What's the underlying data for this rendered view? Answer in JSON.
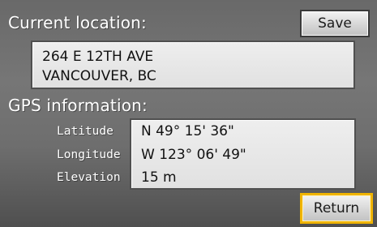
{
  "current_location": {
    "title": "Current location:",
    "save_label": "Save",
    "address_line_1": "264 E 12TH AVE",
    "address_line_2": "VANCOUVER, BC"
  },
  "gps_information": {
    "title": "GPS information:",
    "latitude_label": "Latitude",
    "longitude_label": "Longitude",
    "elevation_label": "Elevation",
    "latitude_value": "N 49° 15' 36\"",
    "longitude_value": "W 123° 06' 49\"",
    "elevation_value": "15 m"
  },
  "footer": {
    "return_label": "Return"
  },
  "colors": {
    "background_top": "#696969",
    "background_bottom": "#4f4f4f",
    "panel": "#e6e6e6",
    "button_highlight": "#f0b400"
  }
}
